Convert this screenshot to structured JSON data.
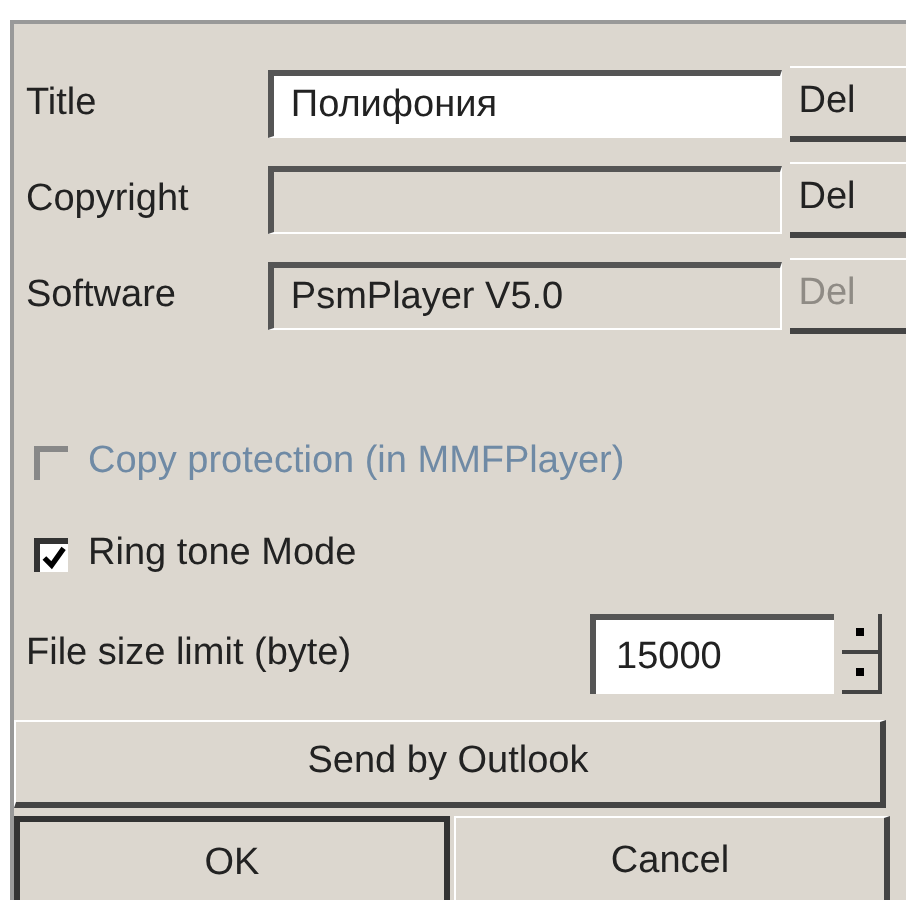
{
  "fields": [
    {
      "label": "Title",
      "value": "Полифония",
      "editable": true,
      "button": {
        "label": "Del",
        "disabled": false
      }
    },
    {
      "label": "Copyright",
      "editable": false,
      "button": {
        "label": "Del",
        "disabled": false
      }
    },
    {
      "label": "Software",
      "value": "PsmPlayer V5.0",
      "editable": false,
      "button": {
        "label": "Del",
        "disabled": true
      }
    }
  ],
  "checkboxes": [
    {
      "label": "Copy protection (in MMFPlayer)",
      "checked": false,
      "disabled": true
    },
    {
      "label": "Ring tone Mode",
      "checked": true,
      "disabled": false
    }
  ],
  "file_size_limit": {
    "label": "File size limit (byte)",
    "value": "15000"
  },
  "send_button": "Send by Outlook",
  "buttons": [
    {
      "label": "OK",
      "default": true
    },
    {
      "label": "Cancel",
      "default": false
    }
  ]
}
